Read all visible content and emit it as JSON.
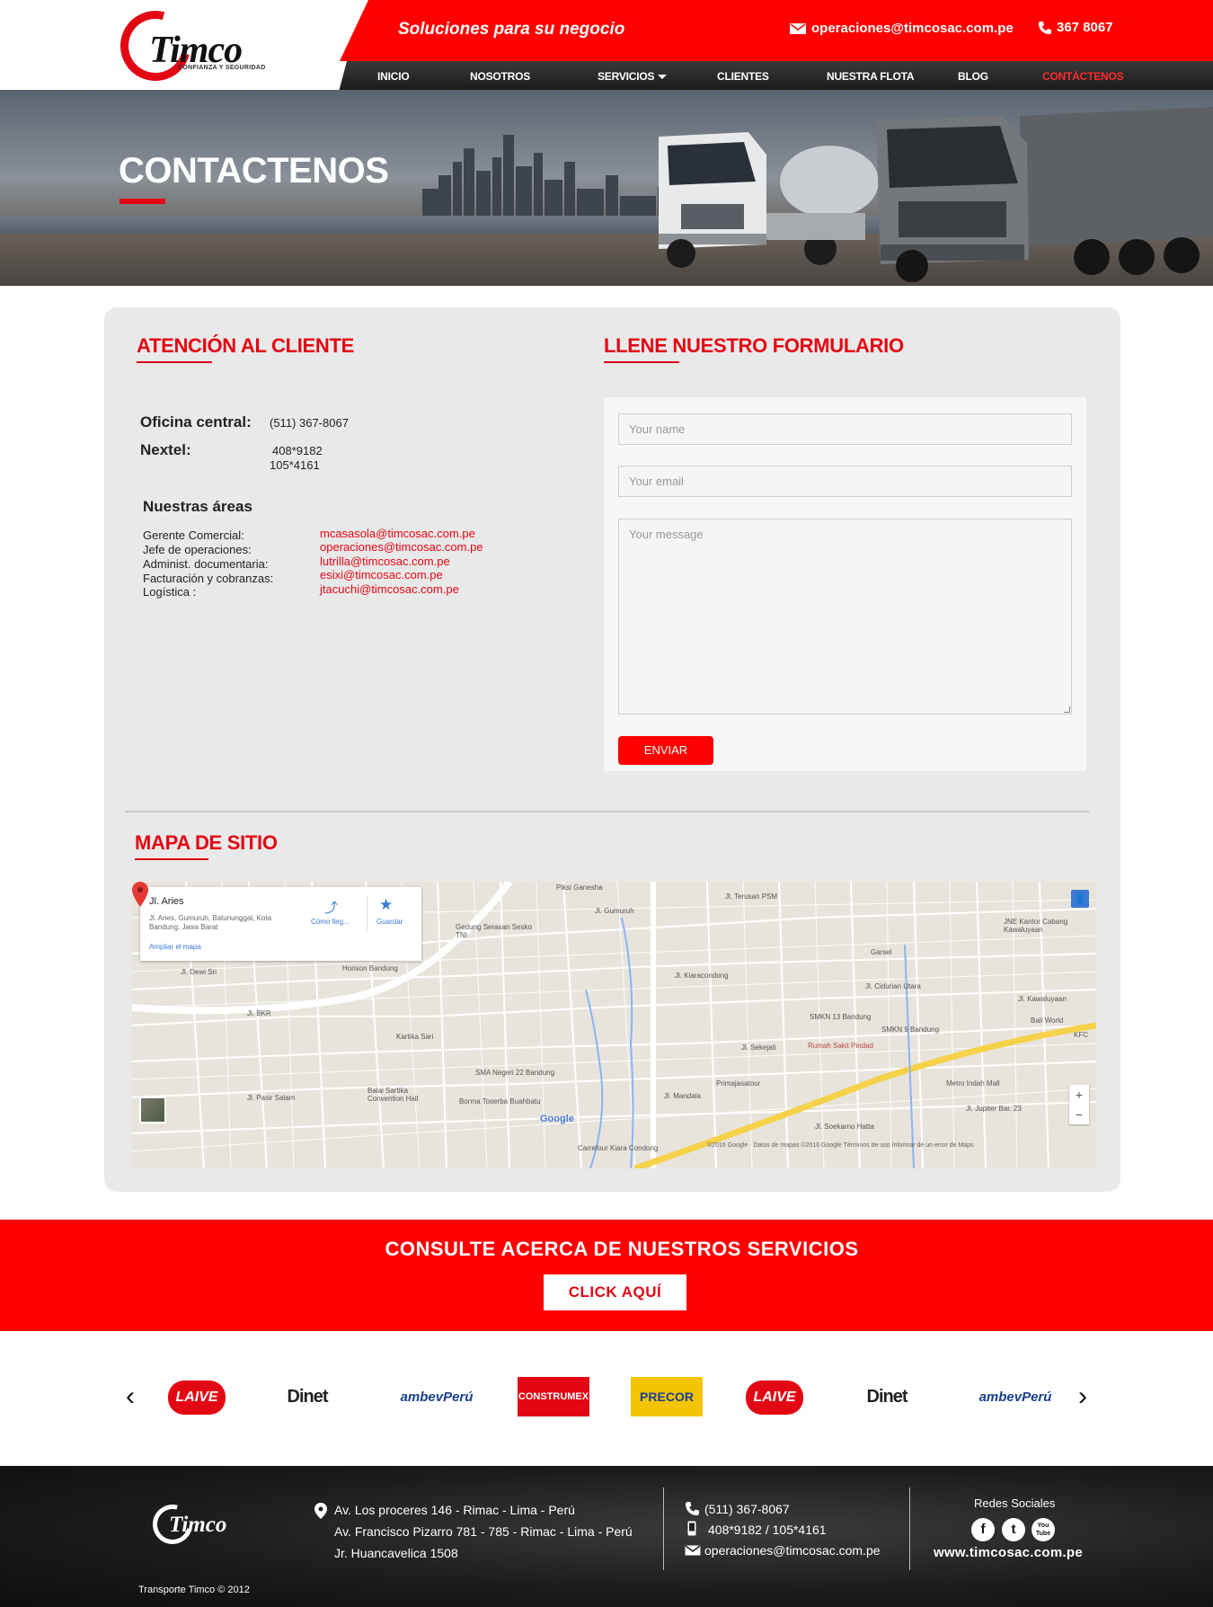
{
  "header": {
    "logo_text": "Timco",
    "logo_tagline": "CONFIANZA Y SEGURIDAD",
    "slogan": "Soluciones  para  su negocio",
    "email": "operaciones@timcosac.com.pe",
    "phone": "367 8067",
    "nav": [
      "INICIO",
      "NOSOTROS",
      "SERVICIOS",
      "CLIENTES",
      "NUESTRA FLOTA",
      "BLOG",
      "CONTÁCTENOS"
    ]
  },
  "hero": {
    "title": "CONTACTENOS"
  },
  "attention": {
    "title": "ATENCIÓN AL CLIENTE",
    "office_label": "Oficina central:",
    "office_value": "(511) 367-8067",
    "nextel_label": "Nextel:",
    "nextel_values": [
      "408*9182",
      "105*4161"
    ],
    "areas_title": "Nuestras áreas",
    "areas": [
      {
        "label": "Gerente Comercial:",
        "email": "mcasasola@timcosac.com.pe"
      },
      {
        "label": "Jefe de operaciones:",
        "email": "operaciones@timcosac.com.pe"
      },
      {
        "label": "Administ. documentaria:",
        "email": "lutrilla@timcosac.com.pe"
      },
      {
        "label": "Facturación y cobranzas:",
        "email": "esixi@timcosac.com.pe"
      },
      {
        "label": "Logística :",
        "email": "jtacuchi@timcosac.com.pe"
      }
    ]
  },
  "form": {
    "title": "LLENE NUESTRO FORMULARIO",
    "name_placeholder": "Your name",
    "email_placeholder": "Your email",
    "message_placeholder": "Your message",
    "submit_label": "ENVIAR"
  },
  "map": {
    "title": "MAPA DE SITIO",
    "place_name": "Jl. Aries",
    "place_address": "Jl. Aries, Gumuruh, Batununggal, Kota Bandung, Jawa Barat",
    "enlarge_label": "Ampliar el mapa",
    "directions_label": "Cómo lleg...",
    "save_label": "Guardar",
    "brand": "Google",
    "attribution": "©2016 Google · Datos de mapas ©2016 Google     Términos de uso     Informar de un error de Maps",
    "labels": [
      "Piksi Ganesha",
      "Jl. Terusan PSM",
      "Gedung Serasan Sesko TNI",
      "JNE Kantor Cabang Kawaluyaan",
      "Horison Bandung",
      "Garsel",
      "Jl. Kawaluyaan",
      "Jl. BKR",
      "Kartika Sari",
      "SMKN 13 Bandung",
      "SMKN 9 Bandung",
      "Bali World",
      "KFC",
      "Rumah Sakit Pindad",
      "Jl. Sekejati",
      "SMA Negeri 22 Bandung",
      "Primajasatour",
      "Metro Indah Mall",
      "Balai Sartika Convention Hall",
      "Borma Toserba Buahbatu",
      "Jl. Mandala",
      "Jl. Pasir Salam",
      "Jl. Jupiter Bar. 23",
      "Carrefour Kiara Condong",
      "Jl. Dewi Sri",
      "Jl. Gumuruh",
      "Jl. Kiaracondong",
      "Jl. Cidurian Utara",
      "Jl. Soekarno Hatta"
    ]
  },
  "cta": {
    "title": "CONSULTE ACERCA DE NUESTROS SERVICIOS",
    "button": "CLICK AQUÍ"
  },
  "clients": [
    "LAIVE",
    "Dinet",
    "ambevPerú",
    "CONSTRUMEX",
    "PRECOR",
    "LAIVE",
    "Dinet",
    "ambevPerú"
  ],
  "footer": {
    "logo_text": "Timco",
    "addresses": [
      "Av. Los proceres 146 - Rimac - Lima - Perú",
      "Av. Francisco Pizarro 781 - 785 - Rimac - Lima - Perú",
      "Jr. Huancavelica 1508"
    ],
    "phone": "(511) 367-8067",
    "nextel": "408*9182 / 105*4161",
    "email": "operaciones@timcosac.com.pe",
    "social_title": "Redes Sociales",
    "social": [
      "f",
      "t",
      "You Tube"
    ],
    "website": "www.timcosac.com.pe",
    "copyright": "Transporte Timco © 2012"
  },
  "colors": {
    "brand_red": "#ff0000",
    "dark": "#151515"
  }
}
